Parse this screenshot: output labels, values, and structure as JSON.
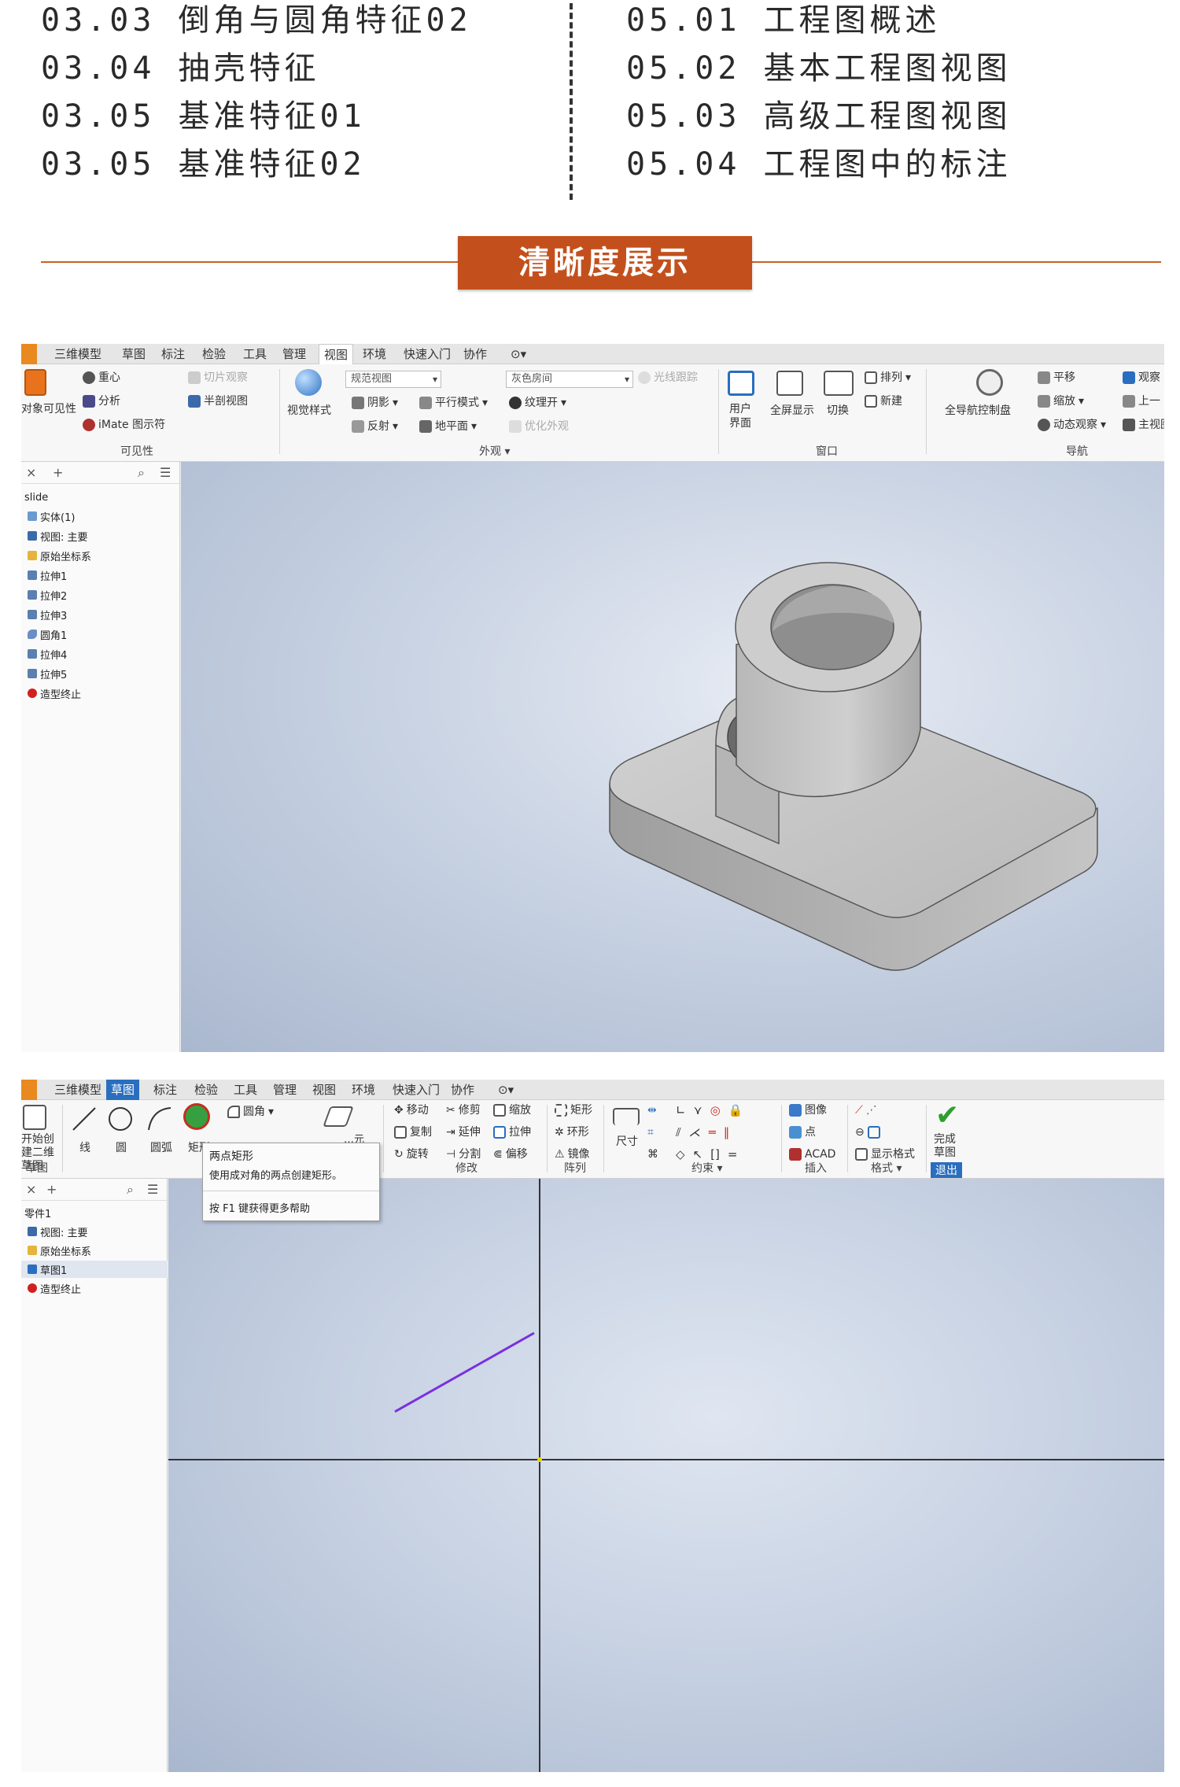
{
  "toc": {
    "left": [
      "03.03 倒角与圆角特征02",
      "03.04 抽壳特征",
      "03.05 基准特征01",
      "03.05 基准特征02"
    ],
    "right": [
      "05.01 工程图概述",
      "05.02 基本工程图视图",
      "05.03 高级工程图视图",
      "05.04 工程图中的标注"
    ]
  },
  "banner": {
    "title": "清晰度展示"
  },
  "colors": {
    "accent": "#c3501c",
    "ribbon_blue": "#2a6ebf",
    "sketch_line": "#7b2fe0",
    "confirm_green": "#2e9e2e"
  },
  "window1": {
    "tabs": [
      "三维模型",
      "草图",
      "标注",
      "检验",
      "工具",
      "管理",
      "视图",
      "环境",
      "快速入门",
      "协作"
    ],
    "active_tab": "视图",
    "ribbon": {
      "visibility": {
        "items": [
          "重心",
          "分析",
          "iMate 图示符"
        ],
        "cut_items": [
          "切片观察",
          "半剖视图"
        ],
        "big_label": "对象可见性",
        "group": "可见性"
      },
      "appearance": {
        "big_label": "视觉样式",
        "combo1": "规范视图",
        "combo2": "灰色房间",
        "items": [
          "阴影",
          "平行模式",
          "纹理开",
          "反射",
          "地平面",
          "光线跟踪",
          "优化外观"
        ],
        "group": "外观"
      },
      "window": {
        "items": [
          "用户界面",
          "全屏显示",
          "切换",
          "排列",
          "新建"
        ],
        "group": "窗口"
      },
      "navigate": {
        "big_label": "全导航控制盘",
        "items": [
          "平移",
          "缩放",
          "动态观察",
          "观察",
          "上一",
          "主视图"
        ],
        "group": "导航"
      }
    },
    "browser": {
      "title": "slide",
      "nodes": [
        "实体(1)",
        "视图: 主要",
        "原始坐标系",
        "拉伸1",
        "拉伸2",
        "拉伸3",
        "圆角1",
        "拉伸4",
        "拉伸5",
        "造型终止"
      ]
    }
  },
  "window2": {
    "tabs": [
      "三维模型",
      "草图",
      "标注",
      "检验",
      "工具",
      "管理",
      "视图",
      "环境",
      "快速入门",
      "协作"
    ],
    "active_tab": "草图",
    "ribbon": {
      "create": {
        "big_label": "开始创建二维草图",
        "items": [
          "线",
          "圆",
          "圆弧",
          "矩形",
          "圆角",
          "投影几何图元"
        ],
        "group": "草图"
      },
      "modify": {
        "items": [
          "移动",
          "修剪",
          "缩放",
          "复制",
          "延伸",
          "拉伸",
          "旋转",
          "分割",
          "偏移"
        ],
        "group": "修改"
      },
      "pattern": {
        "items": [
          "矩形",
          "环形",
          "镜像"
        ],
        "group": "阵列"
      },
      "constrain": {
        "big_label": "尺寸",
        "group": "约束"
      },
      "insert": {
        "items": [
          "图像",
          "点",
          "ACAD"
        ],
        "group": "插入"
      },
      "format": {
        "items": [
          "显示格式"
        ],
        "group": "格式"
      },
      "exit": {
        "big_label": "完成草图",
        "group": "退出"
      }
    },
    "tooltip": {
      "title": "两点矩形",
      "desc": "使用成对角的两点创建矩形。",
      "help": "按 F1 键获得更多帮助"
    },
    "browser": {
      "nodes": [
        "零件1",
        "视图: 主要",
        "原始坐标系",
        "草图1",
        "造型终止"
      ]
    }
  }
}
